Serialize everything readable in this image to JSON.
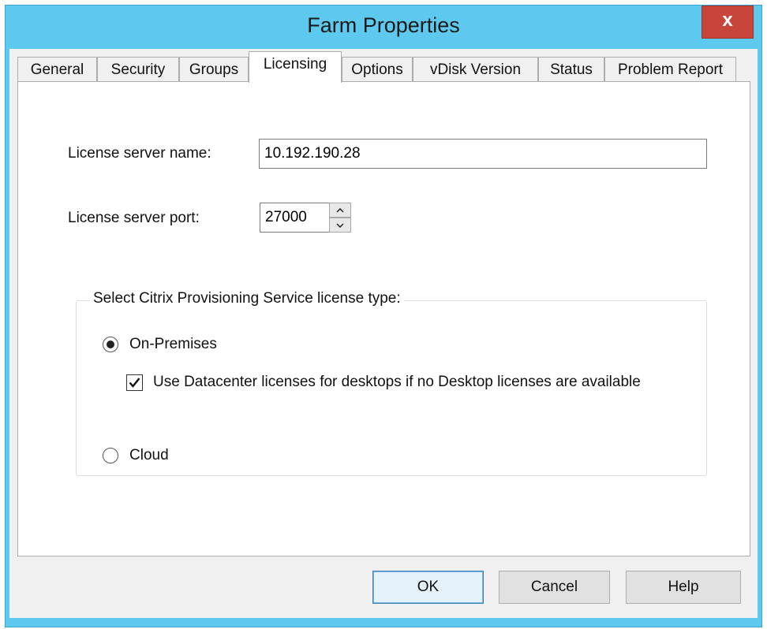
{
  "window": {
    "title": "Farm Properties",
    "close_glyph": "x"
  },
  "tabs": [
    {
      "label": "General"
    },
    {
      "label": "Security"
    },
    {
      "label": "Groups"
    },
    {
      "label": "Licensing",
      "active": true
    },
    {
      "label": "Options"
    },
    {
      "label": "vDisk Version"
    },
    {
      "label": "Status"
    },
    {
      "label": "Problem Report"
    }
  ],
  "licensing": {
    "server_name_label": "License server name:",
    "server_name_value": "10.192.190.28",
    "server_port_label": "License server port:",
    "server_port_value": "27000",
    "license_type_group": "Select Citrix Provisioning Service license type:",
    "on_premises_label": "On-Premises",
    "on_premises_selected": true,
    "datacenter_label": "Use Datacenter licenses for desktops if no Desktop licenses are available",
    "datacenter_checked": true,
    "cloud_label": "Cloud",
    "cloud_selected": false
  },
  "buttons": {
    "ok": "OK",
    "cancel": "Cancel",
    "help": "Help"
  },
  "colors": {
    "titlebar": "#5ec9ee",
    "close": "#c7453a"
  }
}
